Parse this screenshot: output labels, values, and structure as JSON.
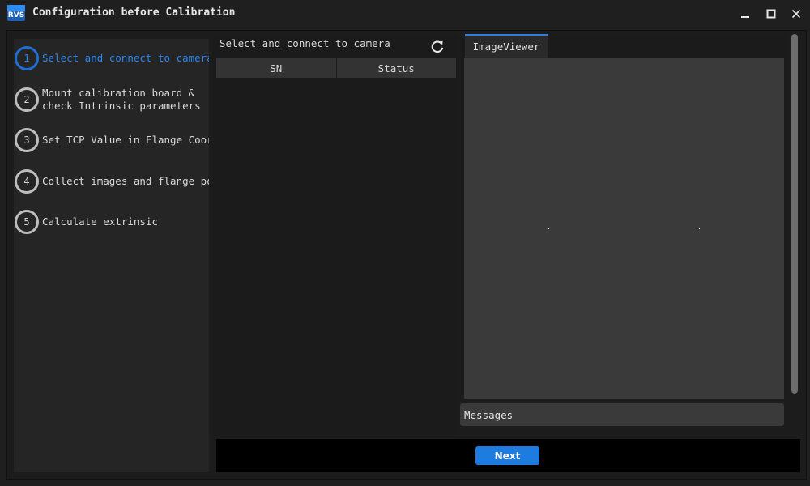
{
  "window": {
    "title": "Configuration before Calibration",
    "logo_text": "RVS",
    "controls": [
      "minimize-icon",
      "maximize-icon",
      "close-icon"
    ]
  },
  "steps": [
    {
      "number": "1",
      "label": "Select and connect to camera",
      "active": true
    },
    {
      "number": "2",
      "label": "Mount calibration board &\ncheck Intrinsic parameters",
      "active": false
    },
    {
      "number": "3",
      "label": "Set TCP Value in Flange Coordinate",
      "active": false
    },
    {
      "number": "4",
      "label": "Collect images and flange pose",
      "active": false
    },
    {
      "number": "5",
      "label": "Calculate extrinsic",
      "active": false
    }
  ],
  "camera_panel": {
    "title": "Select and connect to camera",
    "refresh_icon": "refresh-icon",
    "columns": [
      "SN",
      "Status"
    ],
    "rows": []
  },
  "viewer": {
    "tab_label": "ImageViewer"
  },
  "messages": {
    "label": "Messages"
  },
  "footer": {
    "next_label": "Next"
  },
  "colors": {
    "accent": "#1e7be0",
    "active_text": "#2a86f0",
    "background": "#1f1f1f"
  }
}
